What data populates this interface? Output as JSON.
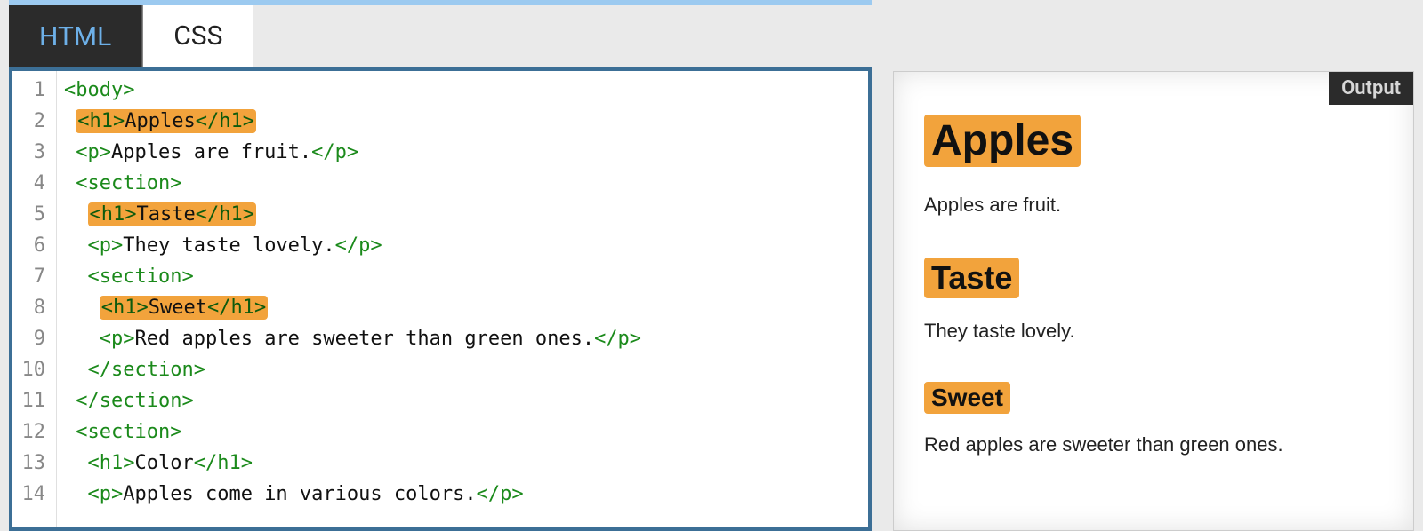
{
  "tabs": {
    "html": "HTML",
    "css": "CSS"
  },
  "code": {
    "lines": [
      {
        "indent": 0,
        "segments": [
          {
            "kind": "tag",
            "text": "<body>"
          }
        ]
      },
      {
        "indent": 1,
        "hl": true,
        "segments": [
          {
            "kind": "tag",
            "text": "<h1>"
          },
          {
            "kind": "txt",
            "text": "Apples"
          },
          {
            "kind": "tag",
            "text": "</h1>"
          }
        ]
      },
      {
        "indent": 1,
        "segments": [
          {
            "kind": "tag",
            "text": "<p>"
          },
          {
            "kind": "txt",
            "text": "Apples are fruit."
          },
          {
            "kind": "tag",
            "text": "</p>"
          }
        ]
      },
      {
        "indent": 1,
        "segments": [
          {
            "kind": "tag",
            "text": "<section>"
          }
        ]
      },
      {
        "indent": 2,
        "hl": true,
        "segments": [
          {
            "kind": "tag",
            "text": "<h1>"
          },
          {
            "kind": "txt",
            "text": "Taste"
          },
          {
            "kind": "tag",
            "text": "</h1>"
          }
        ]
      },
      {
        "indent": 2,
        "segments": [
          {
            "kind": "tag",
            "text": "<p>"
          },
          {
            "kind": "txt",
            "text": "They taste lovely."
          },
          {
            "kind": "tag",
            "text": "</p>"
          }
        ]
      },
      {
        "indent": 2,
        "segments": [
          {
            "kind": "tag",
            "text": "<section>"
          }
        ]
      },
      {
        "indent": 3,
        "hl": true,
        "segments": [
          {
            "kind": "tag",
            "text": "<h1>"
          },
          {
            "kind": "txt",
            "text": "Sweet"
          },
          {
            "kind": "tag",
            "text": "</h1>"
          }
        ]
      },
      {
        "indent": 3,
        "segments": [
          {
            "kind": "tag",
            "text": "<p>"
          },
          {
            "kind": "txt",
            "text": "Red apples are sweeter than green ones."
          },
          {
            "kind": "tag",
            "text": "</p>"
          }
        ]
      },
      {
        "indent": 2,
        "segments": [
          {
            "kind": "tag",
            "text": "</section>"
          }
        ]
      },
      {
        "indent": 1,
        "segments": [
          {
            "kind": "tag",
            "text": "</section>"
          }
        ]
      },
      {
        "indent": 1,
        "segments": [
          {
            "kind": "tag",
            "text": "<section>"
          }
        ]
      },
      {
        "indent": 2,
        "segments": [
          {
            "kind": "tag",
            "text": "<h1>"
          },
          {
            "kind": "txt",
            "text": "Color"
          },
          {
            "kind": "tag",
            "text": "</h1>"
          }
        ]
      },
      {
        "indent": 2,
        "segments": [
          {
            "kind": "tag",
            "text": "<p>"
          },
          {
            "kind": "txt",
            "text": "Apples come in various colors."
          },
          {
            "kind": "tag",
            "text": "</p>"
          }
        ]
      }
    ]
  },
  "output": {
    "label": "Output",
    "h1_lvl1": "Apples",
    "p1": "Apples are fruit.",
    "h1_lvl2": "Taste",
    "p2": "They taste lovely.",
    "h1_lvl3": "Sweet",
    "p3": "Red apples are sweeter than green ones."
  }
}
